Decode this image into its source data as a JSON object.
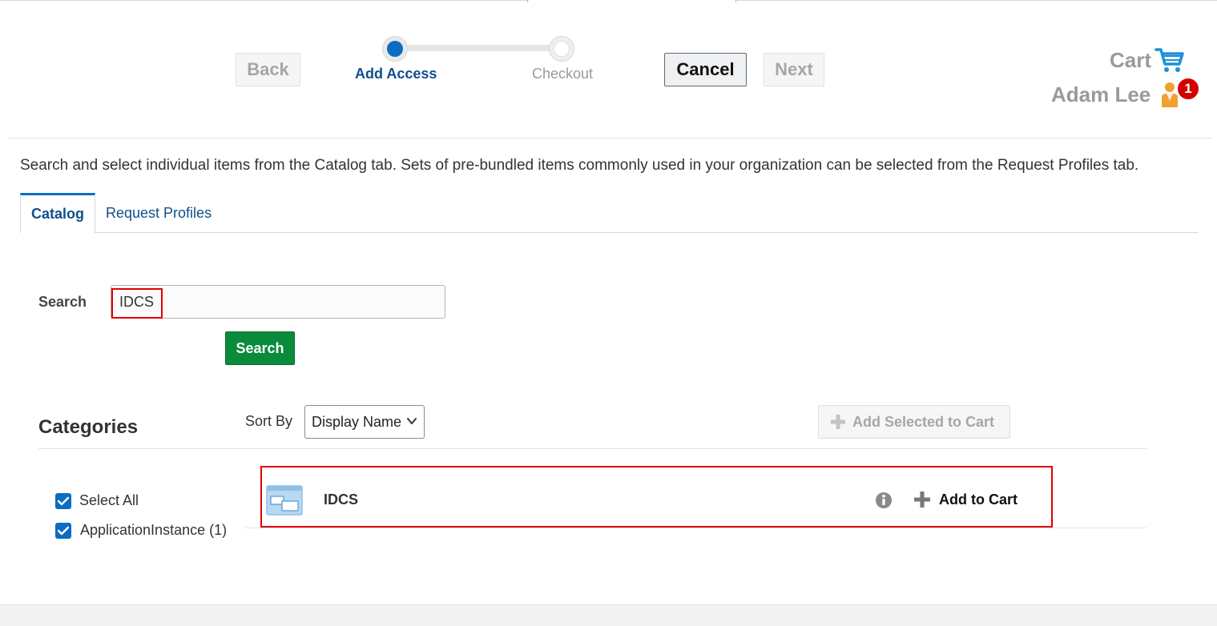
{
  "header": {
    "back_label": "Back",
    "cancel_label": "Cancel",
    "next_label": "Next",
    "train": {
      "steps": [
        "Add Access",
        "Checkout"
      ],
      "current_step": "Add Access"
    },
    "cart_label": "Cart",
    "user_name": "Adam Lee",
    "notification_count": "1"
  },
  "intro_text": "Search and select individual items from the Catalog tab. Sets of pre-bundled items commonly used in your organization can be selected from the Request Profiles tab.",
  "tabs": [
    {
      "label": "Catalog",
      "active": true
    },
    {
      "label": "Request Profiles",
      "active": false
    }
  ],
  "search": {
    "label": "Search",
    "value": "IDCS",
    "button_label": "Search"
  },
  "categories": {
    "title": "Categories",
    "items": [
      {
        "label": "Select All",
        "checked": true
      },
      {
        "label": "ApplicationInstance (1)",
        "checked": true
      }
    ]
  },
  "sort": {
    "label": "Sort By",
    "selected": "Display Name"
  },
  "add_selected_label": "Add Selected to Cart",
  "results": [
    {
      "name": "IDCS",
      "action_label": "Add to Cart",
      "icon": "application-instance-icon"
    }
  ],
  "colors": {
    "accent": "#0a6dc2",
    "primary_button": "#0a8a3b",
    "highlight": "#e00000",
    "badge": "#d10000"
  }
}
